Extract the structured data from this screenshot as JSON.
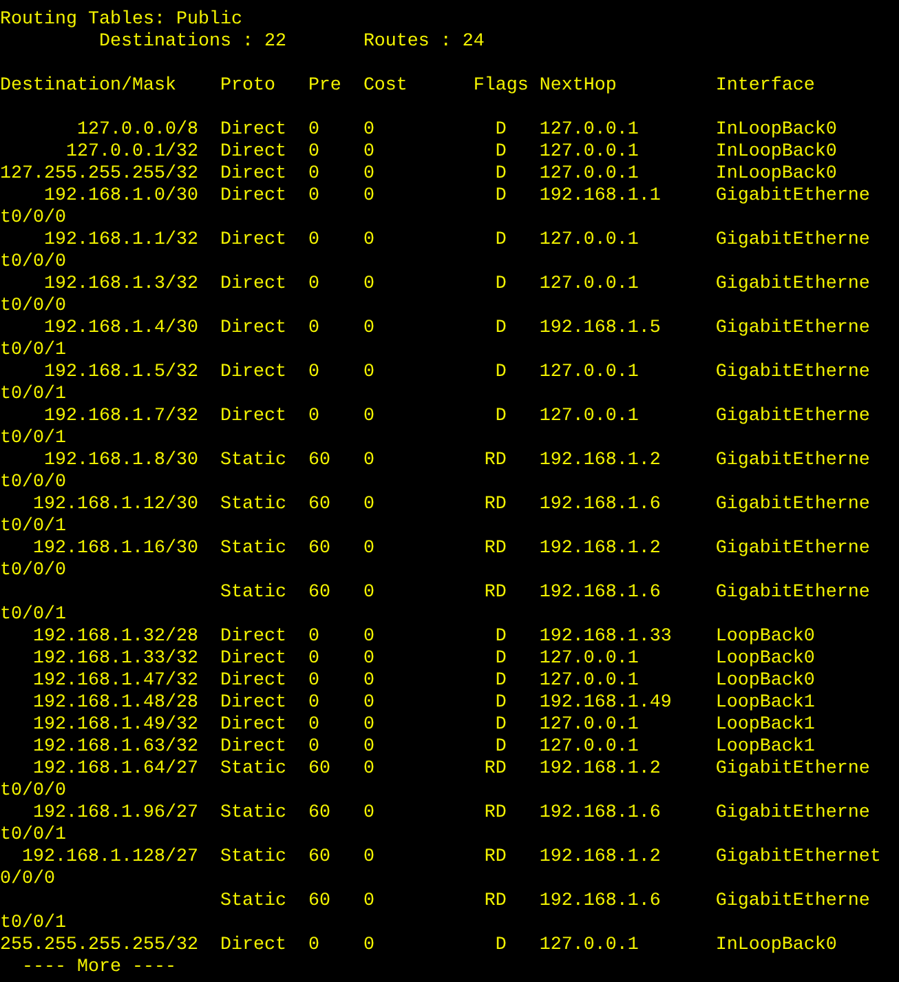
{
  "title": "Routing Tables: Public",
  "summary": [
    "Destinations : 22",
    "Routes : 24"
  ],
  "columns": [
    "Destination/Mask",
    "Proto",
    "Pre",
    "Cost",
    "Flags",
    "NextHop",
    "Interface"
  ],
  "routes": [
    {
      "destination": "127.0.0.0/8",
      "proto": "Direct",
      "pre": "0",
      "cost": "0",
      "flags": "D",
      "nexthop": "127.0.0.1",
      "interface": "InLoopBack0"
    },
    {
      "destination": "127.0.0.1/32",
      "proto": "Direct",
      "pre": "0",
      "cost": "0",
      "flags": "D",
      "nexthop": "127.0.0.1",
      "interface": "InLoopBack0"
    },
    {
      "destination": "127.255.255.255/32",
      "proto": "Direct",
      "pre": "0",
      "cost": "0",
      "flags": "D",
      "nexthop": "127.0.0.1",
      "interface": "InLoopBack0"
    },
    {
      "destination": "192.168.1.0/30",
      "proto": "Direct",
      "pre": "0",
      "cost": "0",
      "flags": "D",
      "nexthop": "192.168.1.1",
      "interface": "GigabitEthernet0/0/0"
    },
    {
      "destination": "192.168.1.1/32",
      "proto": "Direct",
      "pre": "0",
      "cost": "0",
      "flags": "D",
      "nexthop": "127.0.0.1",
      "interface": "GigabitEthernet0/0/0"
    },
    {
      "destination": "192.168.1.3/32",
      "proto": "Direct",
      "pre": "0",
      "cost": "0",
      "flags": "D",
      "nexthop": "127.0.0.1",
      "interface": "GigabitEthernet0/0/0"
    },
    {
      "destination": "192.168.1.4/30",
      "proto": "Direct",
      "pre": "0",
      "cost": "0",
      "flags": "D",
      "nexthop": "192.168.1.5",
      "interface": "GigabitEthernet0/0/1"
    },
    {
      "destination": "192.168.1.5/32",
      "proto": "Direct",
      "pre": "0",
      "cost": "0",
      "flags": "D",
      "nexthop": "127.0.0.1",
      "interface": "GigabitEthernet0/0/1"
    },
    {
      "destination": "192.168.1.7/32",
      "proto": "Direct",
      "pre": "0",
      "cost": "0",
      "flags": "D",
      "nexthop": "127.0.0.1",
      "interface": "GigabitEthernet0/0/1"
    },
    {
      "destination": "192.168.1.8/30",
      "proto": "Static",
      "pre": "60",
      "cost": "0",
      "flags": "RD",
      "nexthop": "192.168.1.2",
      "interface": "GigabitEthernet0/0/0"
    },
    {
      "destination": "192.168.1.12/30",
      "proto": "Static",
      "pre": "60",
      "cost": "0",
      "flags": "RD",
      "nexthop": "192.168.1.6",
      "interface": "GigabitEthernet0/0/1"
    },
    {
      "destination": "192.168.1.16/30",
      "proto": "Static",
      "pre": "60",
      "cost": "0",
      "flags": "RD",
      "nexthop": "192.168.1.2",
      "interface": "GigabitEthernet0/0/0"
    },
    {
      "proto": "Static",
      "pre": "60",
      "cost": "0",
      "flags": "RD",
      "nexthop": "192.168.1.6",
      "interface": "GigabitEthernet0/0/1"
    },
    {
      "destination": "192.168.1.32/28",
      "proto": "Direct",
      "pre": "0",
      "cost": "0",
      "flags": "D",
      "nexthop": "192.168.1.33",
      "interface": "LoopBack0"
    },
    {
      "destination": "192.168.1.33/32",
      "proto": "Direct",
      "pre": "0",
      "cost": "0",
      "flags": "D",
      "nexthop": "127.0.0.1",
      "interface": "LoopBack0"
    },
    {
      "destination": "192.168.1.47/32",
      "proto": "Direct",
      "pre": "0",
      "cost": "0",
      "flags": "D",
      "nexthop": "127.0.0.1",
      "interface": "LoopBack0"
    },
    {
      "destination": "192.168.1.48/28",
      "proto": "Direct",
      "pre": "0",
      "cost": "0",
      "flags": "D",
      "nexthop": "192.168.1.49",
      "interface": "LoopBack1"
    },
    {
      "destination": "192.168.1.49/32",
      "proto": "Direct",
      "pre": "0",
      "cost": "0",
      "flags": "D",
      "nexthop": "127.0.0.1",
      "interface": "LoopBack1"
    },
    {
      "destination": "192.168.1.63/32",
      "proto": "Direct",
      "pre": "0",
      "cost": "0",
      "flags": "D",
      "nexthop": "127.0.0.1",
      "interface": "LoopBack1"
    },
    {
      "destination": "192.168.1.64/27",
      "proto": "Static",
      "pre": "60",
      "cost": "0",
      "flags": "RD",
      "nexthop": "192.168.1.2",
      "interface": "GigabitEthernet0/0/0"
    },
    {
      "destination": "192.168.1.96/27",
      "proto": "Static",
      "pre": "60",
      "cost": "0",
      "flags": "RD",
      "nexthop": "192.168.1.6",
      "interface": "GigabitEthernet0/0/1"
    },
    {
      "destination": "192.168.1.128/27",
      "proto": "Static",
      "pre": "60",
      "cost": "0",
      "flags": "RD",
      "nexthop": "192.168.1.2",
      "interface": "GigabitEthernet0/0/0"
    },
    {
      "proto": "Static",
      "pre": "60",
      "cost": "0",
      "flags": "RD",
      "nexthop": "192.168.1.6",
      "interface": "GigabitEthernet0/0/1"
    },
    {
      "destination": "255.255.255.255/32",
      "proto": "Direct",
      "pre": "0",
      "cost": "0",
      "flags": "D",
      "nexthop": "127.0.0.1",
      "interface": "InLoopBack0"
    }
  ],
  "more_prompt": "---- More ----"
}
